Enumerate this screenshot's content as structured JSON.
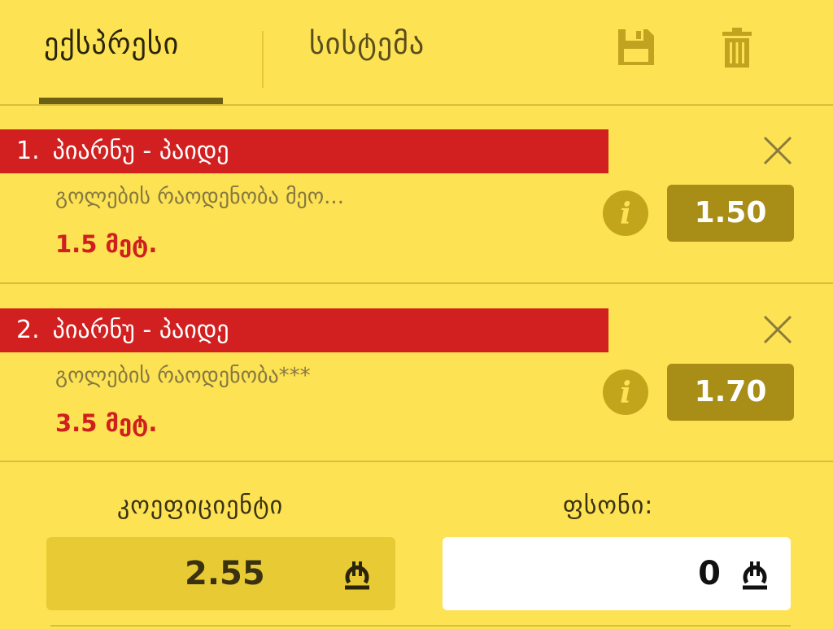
{
  "tabs": {
    "active_label": "ექსპრესი",
    "inactive_label": "სისტემა"
  },
  "toolbar": {
    "save_icon": "save-icon",
    "delete_icon": "trash-icon"
  },
  "bets": [
    {
      "number": "1.",
      "title": "პიარნუ - პაიდე",
      "market": "გოლების რაოდენობა მეო...",
      "selection": "1.5 მეტ.",
      "odds": "1.50"
    },
    {
      "number": "2.",
      "title": "პიარნუ - პაიდე",
      "market": "გოლების რაოდენობა***",
      "selection": "3.5 მეტ.",
      "odds": "1.70"
    }
  ],
  "coefficient": {
    "label": "კოეფიციენტი",
    "value": "2.55",
    "currency_icon": "lari-icon"
  },
  "stake": {
    "label": "ფსონი:",
    "value": "0",
    "currency_icon": "lari-icon"
  },
  "colors": {
    "background": "#fde253",
    "accent_red": "#d21f1f",
    "odds_box": "#a88d17",
    "tab_underline": "#6f5f14"
  }
}
